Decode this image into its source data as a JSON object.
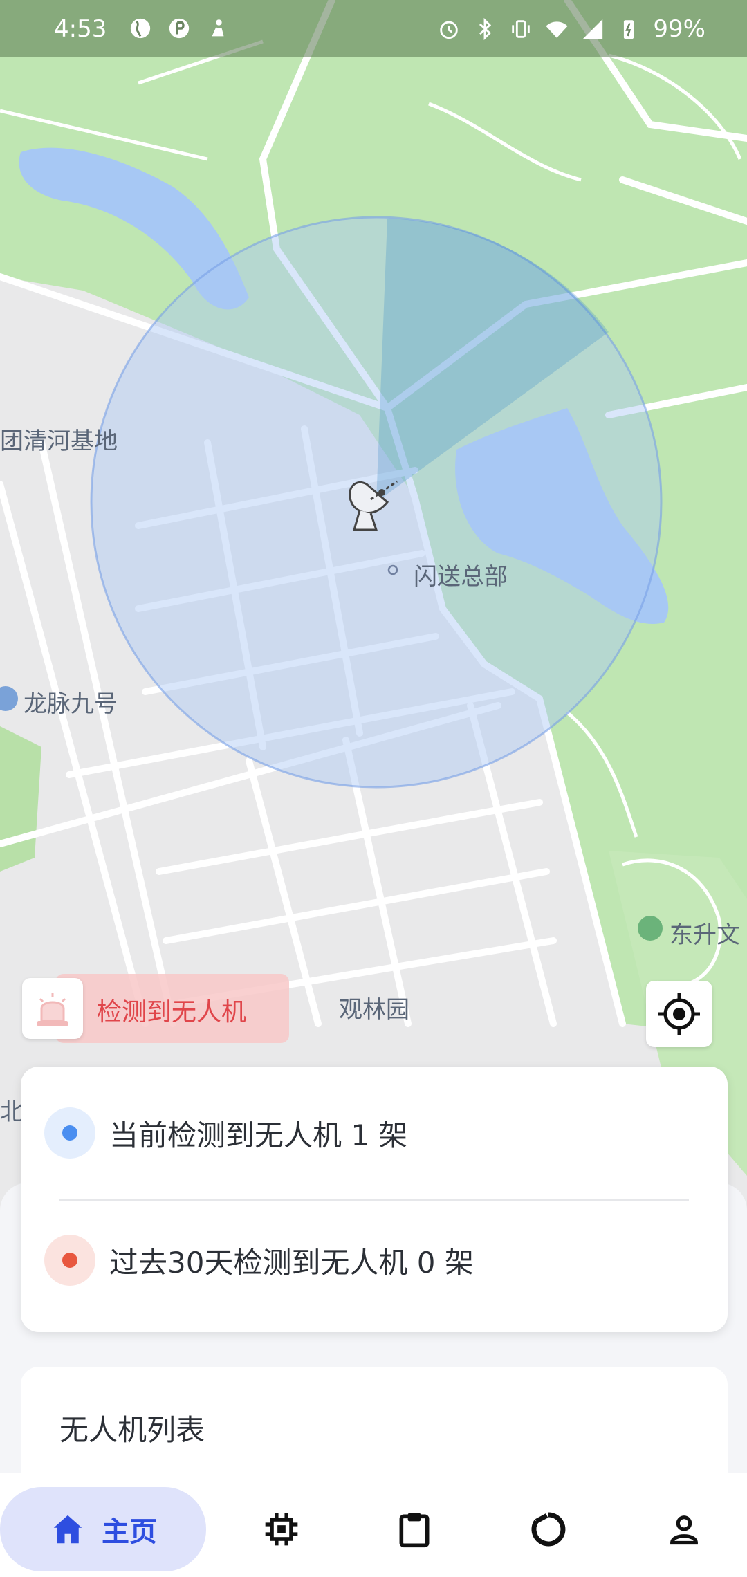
{
  "status_bar": {
    "time": "4:53",
    "battery": "99%",
    "icons": [
      "globe-icon",
      "p-badge-icon",
      "notification-icon",
      "alarm-icon",
      "bluetooth-icon",
      "vibrate-icon",
      "wifi-icon",
      "signal-icon",
      "battery-charging-icon"
    ]
  },
  "map": {
    "labels": {
      "base": "团清河基地",
      "hq": "闪送总部",
      "longmai": "龙脉九号",
      "guanlin": "观林园",
      "dongsheng": "东升文",
      "edge": "北"
    },
    "colors": {
      "park": "#bfe6b2",
      "urban": "#ebebeb",
      "water": "#a7c8f4",
      "radar": "#aac8f0"
    }
  },
  "alert": {
    "label": "检测到无人机",
    "icon": "siren-icon",
    "color": "#e0454a"
  },
  "locate_button": {
    "icon": "locate-icon"
  },
  "stats": {
    "current": {
      "label": "当前检测到无人机 1 架",
      "color": "#4a8ef0"
    },
    "past": {
      "label": "过去30天检测到无人机 0 架",
      "color": "#e8573f"
    }
  },
  "drone_list": {
    "title": "无人机列表"
  },
  "nav": {
    "items": [
      {
        "label": "主页",
        "icon": "home-icon",
        "active": true
      },
      {
        "label": "",
        "icon": "chip-icon"
      },
      {
        "label": "",
        "icon": "clipboard-icon"
      },
      {
        "label": "",
        "icon": "loop-icon"
      },
      {
        "label": "",
        "icon": "user-icon"
      }
    ],
    "accent": "#2e4ee0"
  }
}
